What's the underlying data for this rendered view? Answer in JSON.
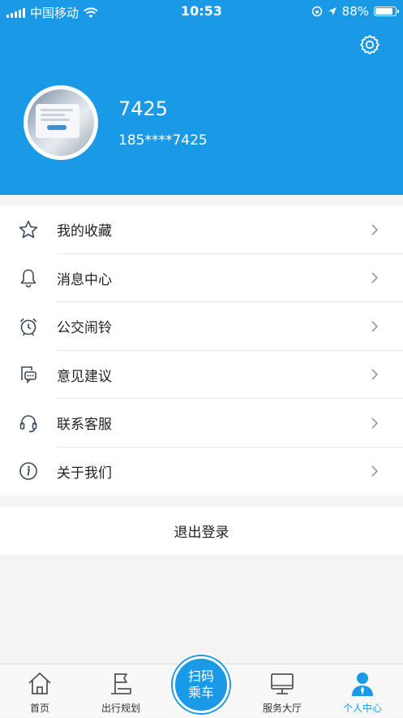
{
  "status_bar": {
    "carrier": "中国移动",
    "time": "10:53",
    "battery": "88%",
    "battery_level": 0.88
  },
  "profile": {
    "username": "7425",
    "phone": "185****7425"
  },
  "menu": {
    "items": [
      {
        "label": "我的收藏",
        "icon": "star-icon"
      },
      {
        "label": "消息中心",
        "icon": "bell-icon"
      },
      {
        "label": "公交闹铃",
        "icon": "alarm-clock-icon"
      },
      {
        "label": "意见建议",
        "icon": "feedback-icon"
      },
      {
        "label": "联系客服",
        "icon": "headset-icon"
      },
      {
        "label": "关于我们",
        "icon": "info-icon"
      }
    ]
  },
  "logout_label": "退出登录",
  "tabbar": {
    "home": "首页",
    "route": "出行规划",
    "scan_line1": "扫码",
    "scan_line2": "乘车",
    "service": "服务大厅",
    "me": "个人中心"
  },
  "colors": {
    "accent": "#1a9ae6",
    "background": "#f4f4f5"
  }
}
